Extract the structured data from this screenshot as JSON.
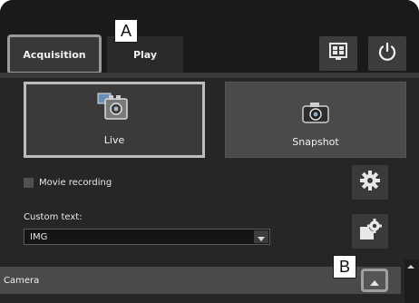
{
  "tabs": [
    {
      "label": "Acquisition",
      "active": true
    },
    {
      "label": "Play",
      "active": false
    }
  ],
  "callouts": {
    "a": "A",
    "b": "B"
  },
  "top_buttons": {
    "display_icon": "display-settings-icon",
    "power_icon": "power-icon"
  },
  "capture": {
    "live_label": "Live",
    "live_icon": "film-camera-icon",
    "snapshot_label": "Snapshot",
    "snapshot_icon": "camera-icon"
  },
  "movie_recording": {
    "label": "Movie recording",
    "checked": false
  },
  "custom_text": {
    "label": "Custom text:",
    "value": "IMG"
  },
  "camera_panel": {
    "label": "Camera"
  },
  "colors": {
    "background": "#232323",
    "button": "#3a3a3a",
    "highlight": "#bdbdbd",
    "text": "#f0f0f0"
  }
}
